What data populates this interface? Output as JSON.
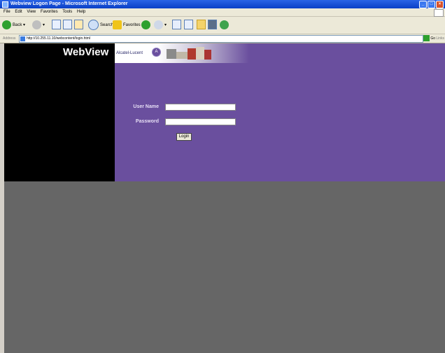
{
  "window": {
    "title": "Webview Logon Page - Microsoft Internet Explorer",
    "controls": [
      "_",
      "□",
      "×"
    ]
  },
  "menu": [
    "File",
    "Edit",
    "View",
    "Favorites",
    "Tools",
    "Help"
  ],
  "toolbar": {
    "back": "Back",
    "search": "Search",
    "favorites": "Favorites"
  },
  "address": {
    "label": "Address",
    "url": "http://10.255.11.10/webcontent/login.html",
    "go": "Go",
    "links": "Links"
  },
  "page": {
    "logo_text": "WebView",
    "brand": "Alcatel-Lucent",
    "form": {
      "username_label": "User Name",
      "password_label": "Password",
      "login_label": "Login",
      "username_value": "",
      "password_value": ""
    }
  },
  "colors": {
    "purple": "#6a4f9e",
    "gray": "#666666",
    "black": "#000000"
  }
}
